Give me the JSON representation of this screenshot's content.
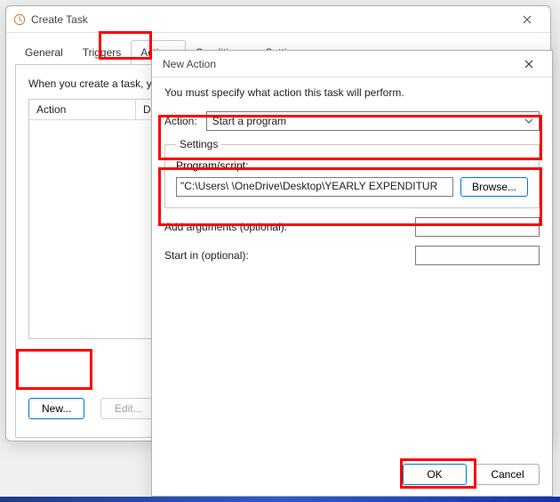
{
  "create_task": {
    "title": "Create Task",
    "tabs": {
      "general": "General",
      "triggers": "Triggers",
      "actions": "Actions",
      "conditions": "Conditions",
      "settings": "Settings"
    },
    "intro": "When you create a task, yo",
    "columns": {
      "action": "Action",
      "details": "Det"
    },
    "buttons": {
      "new": "New...",
      "edit": "Edit..."
    }
  },
  "new_action": {
    "title": "New Action",
    "help": "You must specify what action this task will perform.",
    "action_label": "Action:",
    "action_selected": "Start a program",
    "settings_legend": "Settings",
    "program_label": "Program/script:",
    "program_value": "\"C:\\Users\\          \\OneDrive\\Desktop\\YEARLY EXPENDITUR",
    "browse": "Browse...",
    "args_label": "Add arguments (optional):",
    "args_value": "",
    "startin_label": "Start in (optional):",
    "startin_value": "",
    "ok": "OK",
    "cancel": "Cancel"
  }
}
